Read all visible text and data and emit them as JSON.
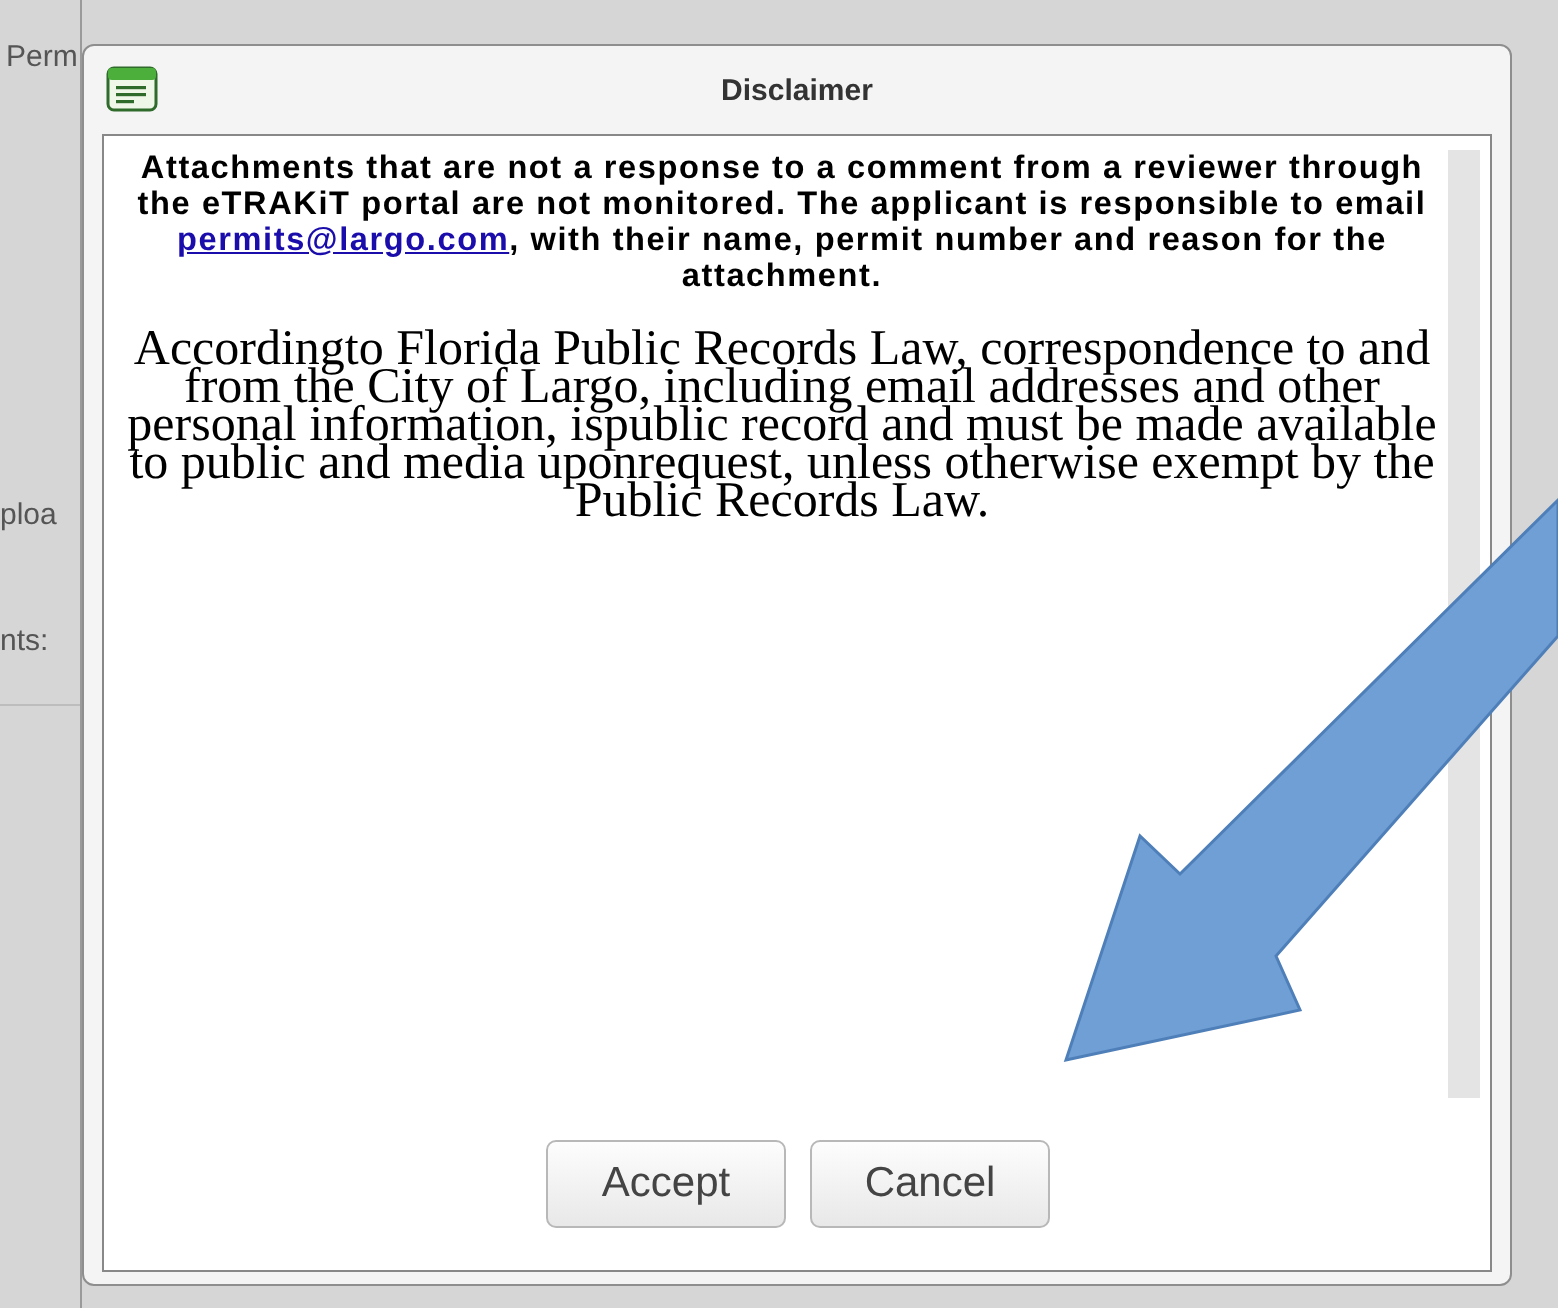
{
  "background_page": {
    "labels": [
      "Perm",
      "ploa",
      "nts:"
    ]
  },
  "dialog": {
    "title": "Disclaimer",
    "notice": {
      "before": "Attachments that are not a response to a comment from a reviewer through the eTRAKiT portal are not monitored. The applicant is responsible to email ",
      "link": "permits@largo.com",
      "after": ", with their name, permit number and reason for the attachment."
    },
    "paragraph": "Accordingto Florida Public Records Law, correspondence to and from the City of Largo, including email addresses and other personal information, ispublic record and must be made available to public and media uponrequest, unless otherwise exempt by the Public Records Law.",
    "buttons": [
      "Accept",
      "Cancel"
    ]
  }
}
